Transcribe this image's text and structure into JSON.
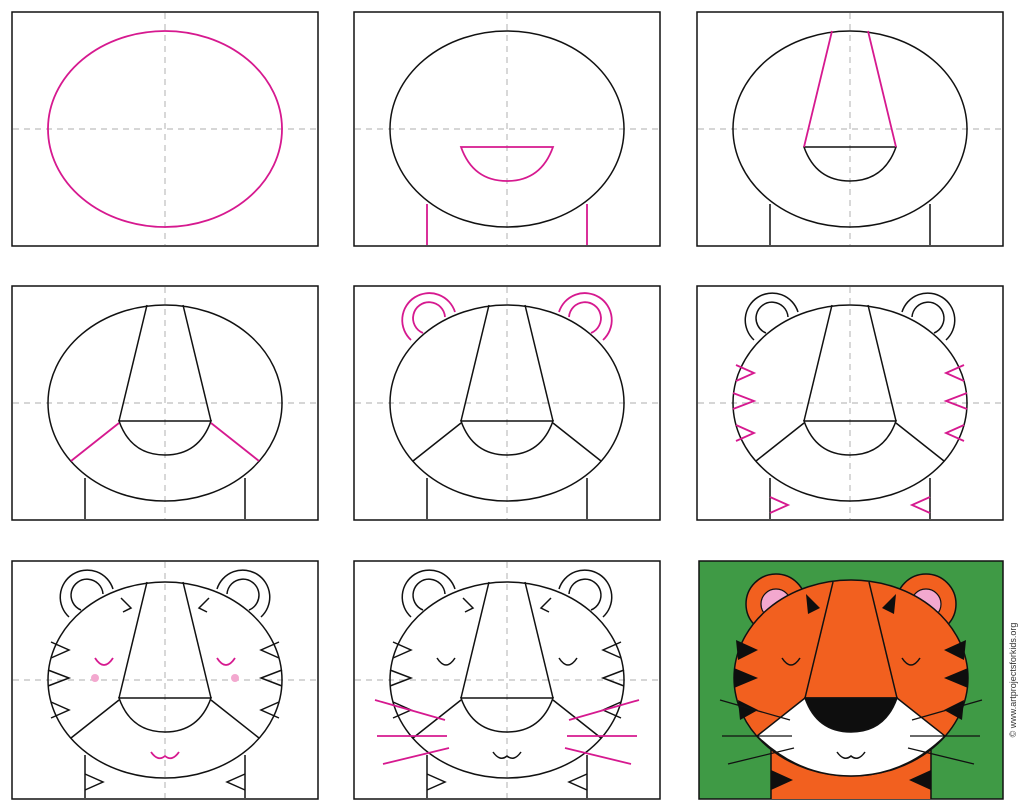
{
  "tutorial": {
    "subject": "tiger face",
    "steps_total": 9
  },
  "colors": {
    "line": "#111111",
    "new_line": "#d6198f",
    "guide": "#bdbdbd",
    "background_green": "#3f9a45",
    "orange": "#f2601f",
    "black": "#0e0e0e",
    "pink": "#f3a8cf",
    "white": "#ffffff"
  },
  "credit": "© www.artprojectsforkids.org"
}
